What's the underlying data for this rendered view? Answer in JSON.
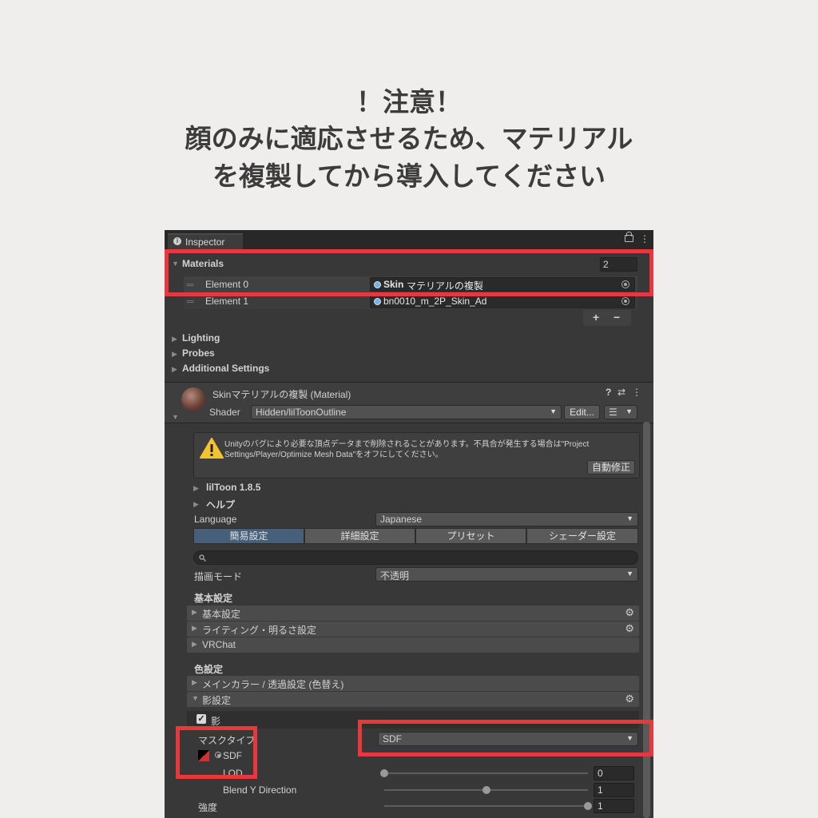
{
  "notice": {
    "line1": "！注意！",
    "line2": "顔のみに適応させるため、マテリアル",
    "line3": "を複製してから導入してください"
  },
  "inspector": {
    "tab_title": "Inspector",
    "materials": {
      "label": "Materials",
      "count": "2",
      "elements": [
        {
          "label": "Element 0",
          "value_bold": "Skin",
          "value_rest": "マテリアルの複製"
        },
        {
          "label": "Element 1",
          "value_bold": "",
          "value_rest": "bn0010_m_2P_Skin_Ad"
        }
      ],
      "add_label": "+",
      "remove_label": "−"
    },
    "sections": [
      "Lighting",
      "Probes",
      "Additional Settings"
    ],
    "material_header": {
      "title": "Skinマテリアルの複製 (Material)",
      "shader_label": "Shader",
      "shader_value": "Hidden/lilToonOutline",
      "edit_label": "Edit...",
      "list_icon": "☰"
    },
    "warning": {
      "text_line1": "Unityのバグにより必要な頂点データまで削除されることがあります。不具合が発生する場合は\"Project",
      "text_line2": "Settings/Player/Optimize Mesh Data\"をオフにしてください。",
      "fix_button": "自動修正"
    },
    "liltoon": {
      "version": "lilToon 1.8.5",
      "help": "ヘルプ",
      "language_label": "Language",
      "language_value": "Japanese",
      "tabs": [
        "簡易設定",
        "詳細設定",
        "プリセット",
        "シェーダー設定"
      ],
      "search_icon": "search-icon",
      "render_mode_label": "描画モード",
      "render_mode_value": "不透明",
      "basic_heading": "基本設定",
      "basic_folds": [
        "基本設定",
        "ライティング・明るさ設定",
        "VRChat"
      ],
      "color_heading": "色設定",
      "color_folds": [
        "メインカラー / 透過設定 (色替え)",
        "影設定"
      ],
      "shadow_toggle": "影",
      "mask_type_label": "マスクタイプ",
      "mask_type_value": "SDF",
      "sdf_label": "SDF",
      "lod_label": "LOD",
      "lod_value": "0",
      "lod_level": 0,
      "blend_label": "Blend Y Direction",
      "blend_value": "1",
      "blend_level": 0.5,
      "strength_label": "強度",
      "strength_value": "1",
      "strength_level": 1
    }
  },
  "colors": {
    "highlight": "#e8383d",
    "panel": "#383838",
    "background": "#efeeec",
    "selected_tab": "#46607c"
  }
}
